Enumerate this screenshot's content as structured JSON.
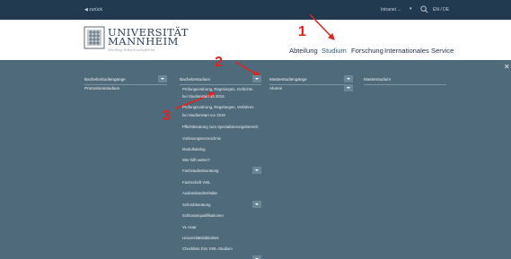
{
  "topbar": {
    "back": "◀ zurück",
    "intranet": "Intranet ...",
    "language": "EN / DE"
  },
  "logo": {
    "line1": "UNIVERSITÄT",
    "line2": "MANNHEIM",
    "tagline": "Abteilung Volkswirtschaftslehre"
  },
  "nav": [
    "Abteilung",
    "Studium",
    "Forschung",
    "Internationales",
    "Service"
  ],
  "markers": [
    "1",
    "2",
    "3"
  ],
  "menu": {
    "col1": [
      "Bachelorstudiengänge",
      "Promotionsstudium"
    ],
    "col2_head": "Bachelorstudium",
    "col3": [
      "Masterstudiengänge",
      "Alumni"
    ],
    "col4": [
      "Masterstudium"
    ],
    "submenu": [
      "Prüfungsordnung, Regelungen, Gefüchte",
      "bei Studienstart ab 2016",
      "Prüfungsordnung, Regelungen, Verfahren",
      "bei Studienstart vor 2016",
      "Pflichtberatung zum Spezialisierungsbereich",
      "Vorlesungsverzeichnis",
      "Modulkatalog",
      "Wer hilft weiter?",
      "Fachstudienberatung",
      "Fachschaft VWL",
      "Auslandsaufenthalte",
      "Schreibberatung",
      "Schlüsselqualifikationen",
      "VL Haar",
      "Universitätsbibliothek",
      "Checkliste fürs VWL-Studium"
    ]
  },
  "colors": {
    "topbar": "#213a50",
    "menu_bg": "#4f6a7a",
    "marker": "#e3221c"
  }
}
